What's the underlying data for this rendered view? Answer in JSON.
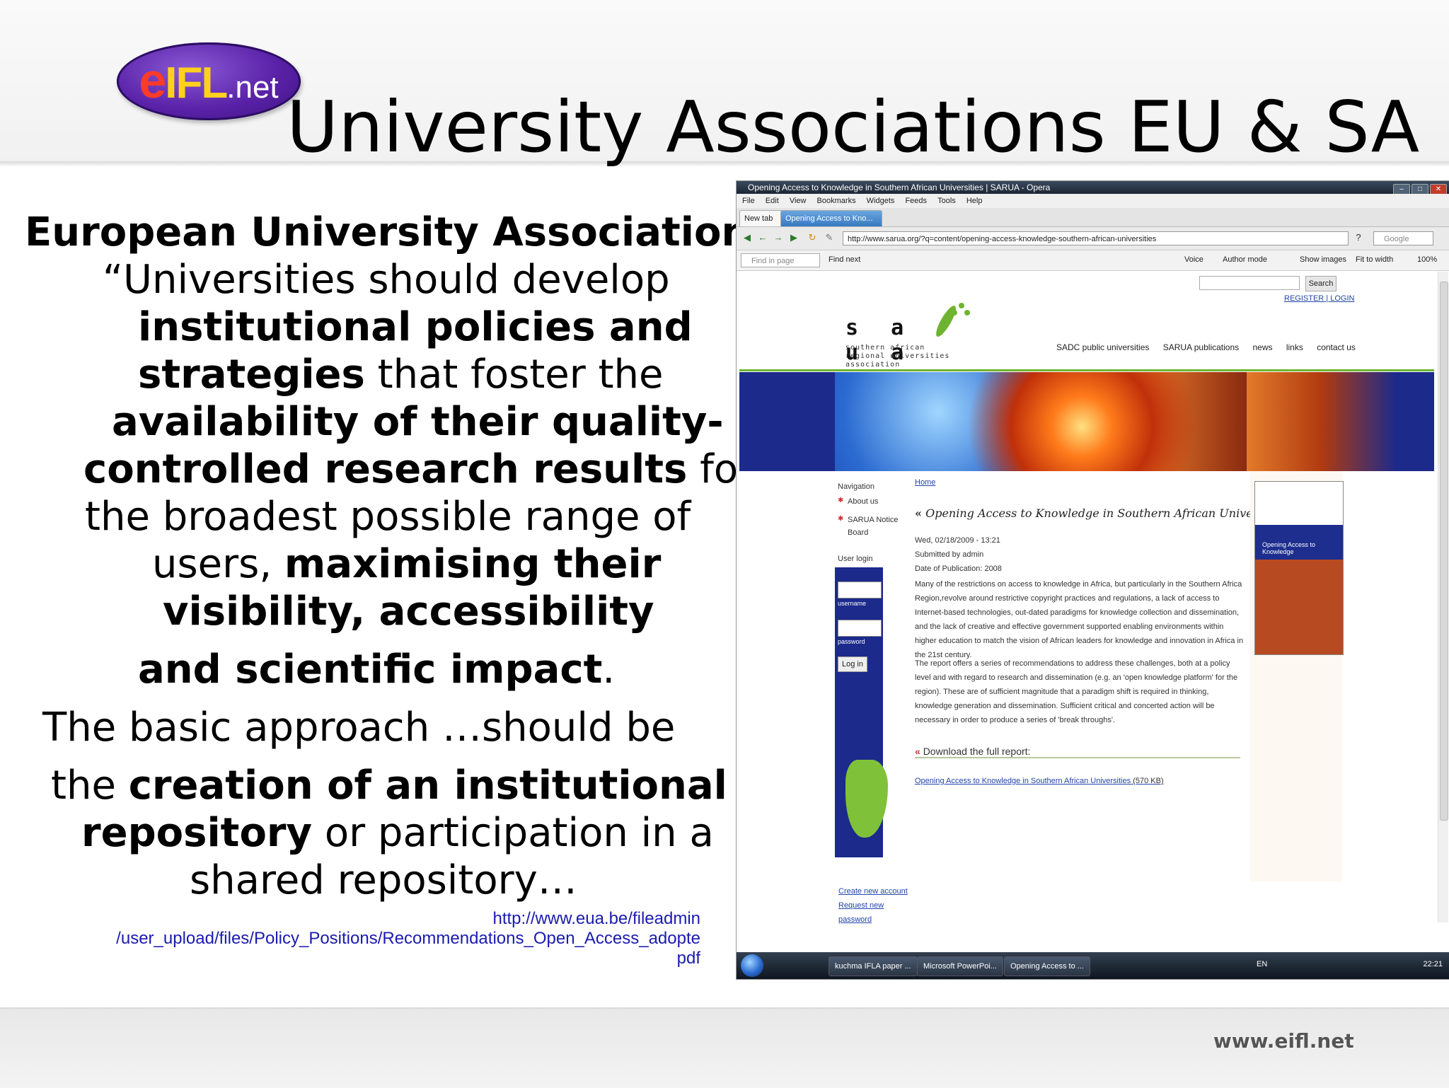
{
  "slide": {
    "title": "University Associations EU & SA",
    "logo_text": {
      "e": "e",
      "ifl": "IFL",
      "net": ".net"
    },
    "footer_url": "www.eifl.net",
    "body_lines": [
      {
        "segments": [
          {
            "t": "European University Association",
            "b": true
          },
          {
            "t": ":",
            "b": false
          }
        ]
      },
      {
        "segments": [
          {
            "t": "“Universities should develop",
            "b": false
          }
        ]
      },
      {
        "segments": [
          {
            "t": "institutional policies and",
            "b": true
          }
        ]
      },
      {
        "segments": [
          {
            "t": "strategies",
            "b": true
          },
          {
            "t": " that foster the",
            "b": false
          }
        ]
      },
      {
        "segments": [
          {
            "t": "availability of their quality-",
            "b": true
          }
        ]
      },
      {
        "segments": [
          {
            "t": "controlled research results",
            "b": true
          },
          {
            "t": " for",
            "b": false
          }
        ]
      },
      {
        "segments": [
          {
            "t": "the broadest possible range of",
            "b": false
          }
        ]
      },
      {
        "segments": [
          {
            "t": "users, ",
            "b": false
          },
          {
            "t": "maximising their",
            "b": true
          }
        ]
      },
      {
        "segments": [
          {
            "t": "visibility, accessibility",
            "b": true
          }
        ]
      },
      {
        "segments": [
          {
            "t": "and scientific impact",
            "b": true
          },
          {
            "t": ".",
            "b": false
          }
        ]
      },
      {
        "segments": [
          {
            "t": "The basic approach …should be",
            "b": false
          }
        ]
      },
      {
        "segments": [
          {
            "t": "the ",
            "b": false
          },
          {
            "t": "creation of an institutional",
            "b": true
          }
        ]
      },
      {
        "segments": [
          {
            "t": "repository",
            "b": true
          },
          {
            "t": " or participation in a",
            "b": false
          }
        ]
      },
      {
        "segments": [
          {
            "t": "shared repository…",
            "b": false
          }
        ]
      }
    ],
    "source_url_lines": [
      "http://www.eua.be/fileadmin",
      "/user_upload/files/Policy_Positions/Recommendations_Open_Access_adopte",
      "pdf"
    ]
  },
  "browser": {
    "window_title": "Opening Access to Knowledge in Southern African Universities | SARUA - Opera",
    "menu": [
      "File",
      "Edit",
      "View",
      "Bookmarks",
      "Widgets",
      "Feeds",
      "Tools",
      "Help"
    ],
    "tabs": [
      "New tab",
      "Opening Access to Kno..."
    ],
    "url": "http://www.sarua.org/?q=content/opening-access-knowledge-southern-african-universities",
    "search_engine": "Google",
    "find_placeholder": "Find in page",
    "find_next": "Find next",
    "toolbar_right": [
      "Voice",
      "Author mode",
      "Show images",
      "Fit to width",
      "100%"
    ],
    "page": {
      "search_button": "Search",
      "register": "REGISTER",
      "login": "LOGIN",
      "logo_word": "s a r u a",
      "logo_sub": "southern african regional universities association",
      "top_nav": [
        "SADC public universities",
        "SARUA publications",
        "news",
        "links",
        "contact us"
      ],
      "navigation_title": "Navigation",
      "nav_items": [
        "About us",
        "SARUA Notice Board"
      ],
      "user_login_title": "User login",
      "username_label": "username",
      "password_label": "password",
      "login_button": "Log in",
      "left_links": [
        "Create new account",
        "Request new",
        "password"
      ],
      "breadcrumb": "Home",
      "heading": "Opening Access to Knowledge in Southern African Universities",
      "date": "Wed, 02/18/2009 - 13:21",
      "submitted": "Submitted by admin",
      "publication_date": "Date of Publication: 2008",
      "para1": "Many of the restrictions on access to knowledge in Africa, but particularly in the Southern Africa Region,revolve around restrictive copyright practices and regulations, a lack of access to Internet-based technologies, out-dated paradigms for knowledge collection and dissemination, and the lack of creative and effective government supported enabling environments within higher education to match the vision of African leaders for knowledge and innovation in Africa in the 21st century.",
      "para2": "The report offers a series of recommendations to address these challenges, both at a policy level and with regard to research and dissemination (e.g. an 'open knowledge platform' for the region). These are of sufficient magnitude that a paradigm shift is required in thinking, knowledge generation and dissemination. Sufficient critical and concerted action will be necessary in order to produce a series of 'break throughs'.",
      "download_heading": "Download the full report:",
      "download_link": "Opening Access to Knowledge in Southern African Universities",
      "download_size": "(570 KB)",
      "book_title": "Opening Access to Knowledge"
    },
    "taskbar": {
      "items": [
        "kuchma IFLA paper ...",
        "Microsoft PowerPoi...",
        "Opening Access to ..."
      ],
      "lang": "EN",
      "clock": "22:21"
    }
  }
}
